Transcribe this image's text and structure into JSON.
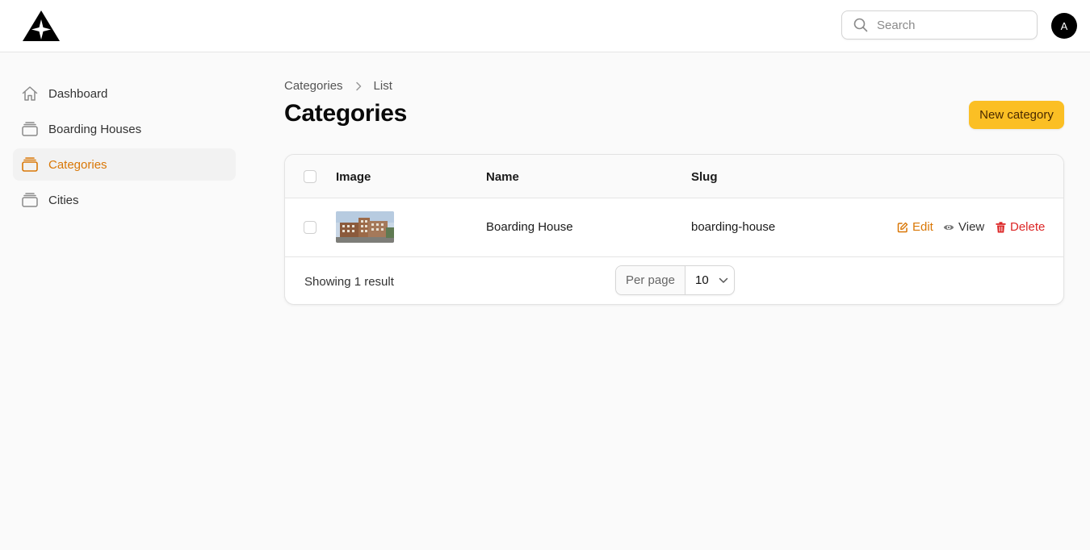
{
  "header": {
    "search_placeholder": "Search",
    "avatar_initial": "A"
  },
  "sidebar": {
    "items": [
      {
        "label": "Dashboard",
        "icon": "home-icon",
        "active": false
      },
      {
        "label": "Boarding Houses",
        "icon": "stack-icon",
        "active": false
      },
      {
        "label": "Categories",
        "icon": "stack-icon",
        "active": true
      },
      {
        "label": "Cities",
        "icon": "stack-icon",
        "active": false
      }
    ]
  },
  "breadcrumb": {
    "items": [
      "Categories",
      "List"
    ]
  },
  "page": {
    "title": "Categories",
    "new_button": "New category"
  },
  "table": {
    "headers": {
      "image": "Image",
      "name": "Name",
      "slug": "Slug"
    },
    "rows": [
      {
        "name": "Boarding House",
        "slug": "boarding-house",
        "image": "building-photo"
      }
    ],
    "actions": {
      "edit": "Edit",
      "view": "View",
      "delete": "Delete"
    },
    "footer": {
      "showing": "Showing 1 result",
      "per_page_label": "Per page",
      "per_page_value": "10"
    }
  },
  "colors": {
    "accent": "#d97706",
    "primary_button": "#fbbf24",
    "delete": "#dc2626"
  }
}
